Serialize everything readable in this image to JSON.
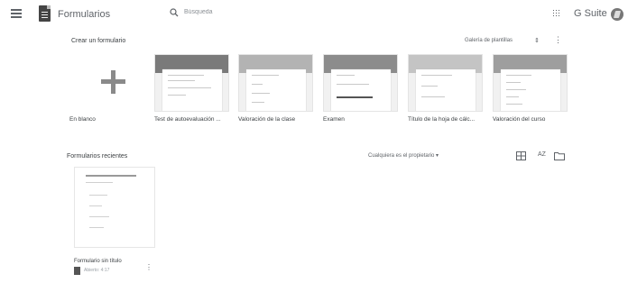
{
  "header": {
    "app_title": "Formularios",
    "search_placeholder": "Búsqueda",
    "brand": "G Suite"
  },
  "templates_section": {
    "title": "Crear un formulario",
    "gallery_label": "Galería de plantillas",
    "items": [
      {
        "label": "En blanco"
      },
      {
        "label": "Test de autoevaluación ..."
      },
      {
        "label": "Valoración de la clase"
      },
      {
        "label": "Examen"
      },
      {
        "label": "Título de la hoja de cálc..."
      },
      {
        "label": "Valoración del curso"
      }
    ]
  },
  "recent_section": {
    "title": "Formularios recientes",
    "owner_filter": "Cualquiera es el propietario ▾",
    "sort_label": "AZ",
    "files": [
      {
        "title": "Formulario sin título",
        "opened": "Abierto: 4:17"
      }
    ]
  }
}
